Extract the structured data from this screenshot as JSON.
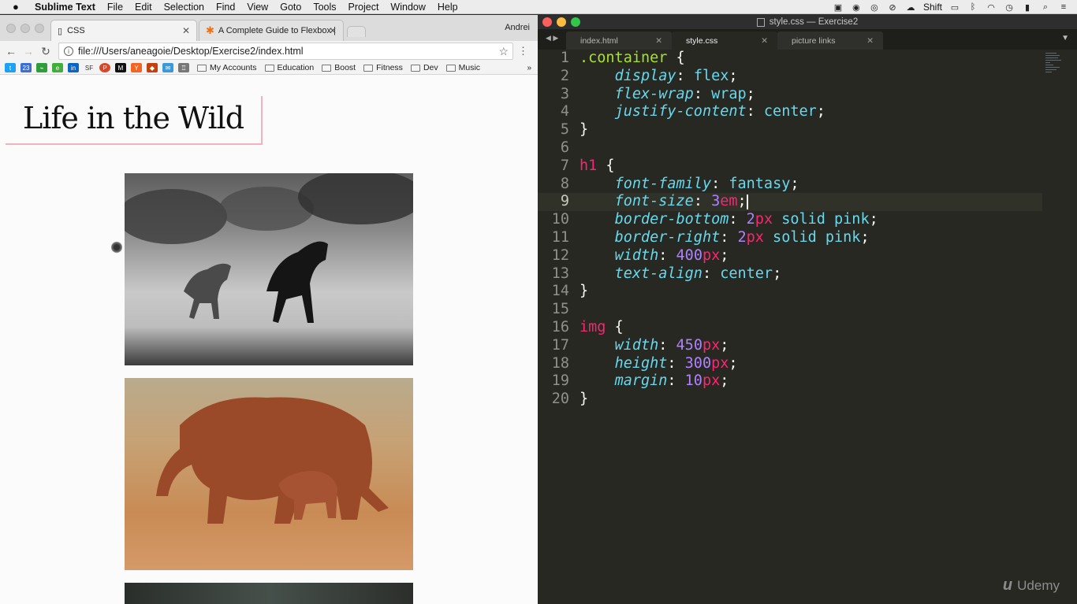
{
  "menubar": {
    "app": "Sublime Text",
    "items": [
      "File",
      "Edit",
      "Selection",
      "Find",
      "View",
      "Goto",
      "Tools",
      "Project",
      "Window",
      "Help"
    ],
    "shift_label": "Shift"
  },
  "browser": {
    "tabs": [
      {
        "label": "CSS",
        "active": true
      },
      {
        "label": "A Complete Guide to Flexbox |",
        "active": false
      }
    ],
    "user": "Andrei",
    "url": "file:///Users/aneagoie/Desktop/Exercise2/index.html",
    "bookmark_icons": [
      "twitter-icon",
      "calendar-icon",
      "bookmark-green-icon",
      "evernote-icon",
      "linkedin-icon",
      "sf-icon",
      "producthunt-icon",
      "medium-icon",
      "ycombinator-icon",
      "app-icon",
      "app2-icon",
      "app3-icon"
    ],
    "bookmark_text_sf": "SF",
    "bookmark_text_p": "P",
    "bookmark_text_m": "M",
    "bookmark_text_y": "Y",
    "bookmark_text_in": "in",
    "bookmark_text_23": "23",
    "bookmark_folders": [
      "My Accounts",
      "Education",
      "Boost",
      "Fitness",
      "Dev",
      "Music"
    ],
    "page": {
      "heading": "Life in the Wild"
    }
  },
  "editor": {
    "window_title": "style.css — Exercise2",
    "tabs": [
      {
        "label": "index.html",
        "active": false
      },
      {
        "label": "style.css",
        "active": true
      },
      {
        "label": "picture links",
        "active": false
      }
    ],
    "watermark": "Udemy"
  },
  "colors": {
    "editor_bg": "#272822",
    "keyword": "#f92672",
    "selector": "#a6e22e",
    "property": "#66d9ef",
    "number": "#ae81ff",
    "border_pink": "#f2b2bf"
  }
}
